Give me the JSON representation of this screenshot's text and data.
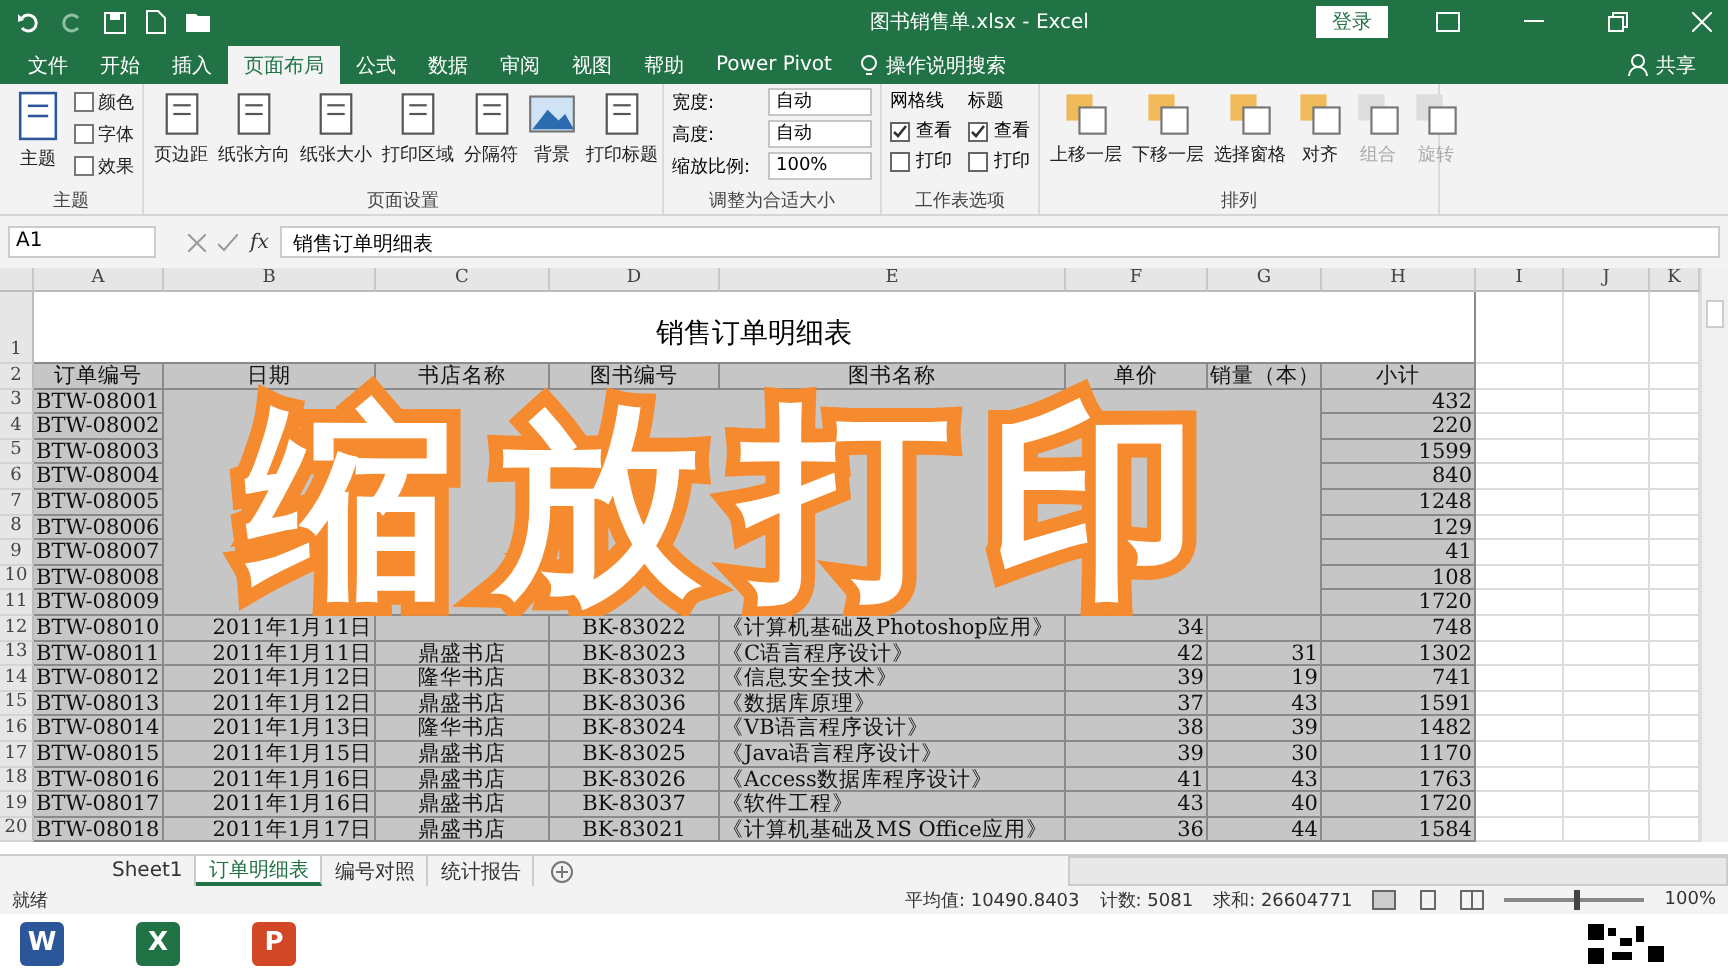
{
  "title_bar": {
    "title": "图书销售单.xlsx  -  Excel",
    "sign_in": "登录"
  },
  "ribbon_tabs": [
    {
      "label": "文件",
      "selected": false
    },
    {
      "label": "开始",
      "selected": false
    },
    {
      "label": "插入",
      "selected": false
    },
    {
      "label": "页面布局",
      "selected": true
    },
    {
      "label": "公式",
      "selected": false
    },
    {
      "label": "数据",
      "selected": false
    },
    {
      "label": "审阅",
      "selected": false
    },
    {
      "label": "视图",
      "selected": false
    },
    {
      "label": "帮助",
      "selected": false
    },
    {
      "label": "Power Pivot",
      "selected": false
    }
  ],
  "tell_me": "操作说明搜索",
  "share": "共享",
  "theme_group": {
    "label": "主题",
    "big": "主题",
    "items": [
      "颜色",
      "字体",
      "效果"
    ]
  },
  "page_setup": {
    "label": "页面设置",
    "buttons": [
      "页边距",
      "纸张方向",
      "纸张大小",
      "打印区域",
      "分隔符",
      "背景",
      "打印标题"
    ]
  },
  "scale_to_fit": {
    "label": "调整为合适大小",
    "fields": [
      {
        "label": "宽度:",
        "value": "自动"
      },
      {
        "label": "高度:",
        "value": "自动"
      },
      {
        "label": "缩放比例:",
        "value": "100%"
      }
    ]
  },
  "sheet_options": {
    "label": "工作表选项",
    "columns": [
      {
        "heading": "网格线",
        "options": [
          {
            "label": "查看",
            "checked": true
          },
          {
            "label": "打印",
            "checked": false
          }
        ]
      },
      {
        "heading": "标题",
        "options": [
          {
            "label": "查看",
            "checked": true
          },
          {
            "label": "打印",
            "checked": false
          }
        ]
      }
    ]
  },
  "arrange": {
    "label": "排列",
    "buttons": [
      {
        "label": "上移一层",
        "disabled": false
      },
      {
        "label": "下移一层",
        "disabled": false
      },
      {
        "label": "选择窗格",
        "disabled": false
      },
      {
        "label": "对齐",
        "disabled": false
      },
      {
        "label": "组合",
        "disabled": true
      },
      {
        "label": "旋转",
        "disabled": true
      }
    ]
  },
  "formula_bar": {
    "name_box": "A1",
    "function_symbol": "fx",
    "value": "销售订单明细表"
  },
  "sheet": {
    "columns": [
      "A",
      "B",
      "C",
      "D",
      "E",
      "F",
      "G",
      "H",
      "I",
      "J",
      "K"
    ],
    "title_row": "1",
    "title": "销售订单明细表",
    "header_row": "2",
    "headers": [
      "订单编号",
      "日期",
      "书店名称",
      "图书编号",
      "图书名称",
      "单价",
      "销量（本）",
      "小计"
    ],
    "rows": [
      {
        "number": "3",
        "cells": [
          "BTW-08001",
          null,
          null,
          null,
          null,
          null,
          null,
          "432"
        ]
      },
      {
        "number": "4",
        "cells": [
          "BTW-08002",
          null,
          null,
          null,
          null,
          null,
          null,
          "220"
        ]
      },
      {
        "number": "5",
        "cells": [
          "BTW-08003",
          null,
          null,
          null,
          null,
          null,
          null,
          "1599"
        ]
      },
      {
        "number": "6",
        "cells": [
          "BTW-08004",
          null,
          null,
          null,
          null,
          null,
          null,
          "840"
        ]
      },
      {
        "number": "7",
        "cells": [
          "BTW-08005",
          null,
          null,
          null,
          null,
          null,
          null,
          "1248"
        ]
      },
      {
        "number": "8",
        "cells": [
          "BTW-08006",
          null,
          null,
          null,
          null,
          null,
          null,
          "129"
        ]
      },
      {
        "number": "9",
        "cells": [
          "BTW-08007",
          null,
          null,
          null,
          null,
          null,
          null,
          "41"
        ]
      },
      {
        "number": "10",
        "cells": [
          "BTW-08008",
          null,
          null,
          null,
          null,
          null,
          null,
          "108"
        ]
      },
      {
        "number": "11",
        "cells": [
          "BTW-08009",
          null,
          null,
          null,
          null,
          null,
          null,
          "1720"
        ]
      },
      {
        "number": "12",
        "cells": [
          "BTW-08010",
          "2011年1月11日",
          null,
          "BK-83022",
          "《计算机基础及Photoshop应用》",
          "34",
          null,
          "748"
        ]
      },
      {
        "number": "13",
        "cells": [
          "BTW-08011",
          "2011年1月11日",
          "鼎盛书店",
          "BK-83023",
          "《C语言程序设计》",
          "42",
          "31",
          "1302"
        ]
      },
      {
        "number": "14",
        "cells": [
          "BTW-08012",
          "2011年1月12日",
          "隆华书店",
          "BK-83032",
          "《信息安全技术》",
          "39",
          "19",
          "741"
        ]
      },
      {
        "number": "15",
        "cells": [
          "BTW-08013",
          "2011年1月12日",
          "鼎盛书店",
          "BK-83036",
          "《数据库原理》",
          "37",
          "43",
          "1591"
        ]
      },
      {
        "number": "16",
        "cells": [
          "BTW-08014",
          "2011年1月13日",
          "隆华书店",
          "BK-83024",
          "《VB语言程序设计》",
          "38",
          "39",
          "1482"
        ]
      },
      {
        "number": "17",
        "cells": [
          "BTW-08015",
          "2011年1月15日",
          "鼎盛书店",
          "BK-83025",
          "《Java语言程序设计》",
          "39",
          "30",
          "1170"
        ]
      },
      {
        "number": "18",
        "cells": [
          "BTW-08016",
          "2011年1月16日",
          "鼎盛书店",
          "BK-83026",
          "《Access数据库程序设计》",
          "41",
          "43",
          "1763"
        ]
      },
      {
        "number": "19",
        "cells": [
          "BTW-08017",
          "2011年1月16日",
          "鼎盛书店",
          "BK-83037",
          "《软件工程》",
          "43",
          "40",
          "1720"
        ]
      },
      {
        "number": "20",
        "cells": [
          "BTW-08018",
          "2011年1月17日",
          "鼎盛书店",
          "BK-83021",
          "《计算机基础及MS Office应用》",
          "36",
          "44",
          "1584"
        ]
      }
    ]
  },
  "caption": "缩放打印",
  "sheet_tabs": [
    {
      "label": "Sheet1",
      "selected": false
    },
    {
      "label": "订单明细表",
      "selected": true
    },
    {
      "label": "编号对照",
      "selected": false
    },
    {
      "label": "统计报告",
      "selected": false
    }
  ],
  "status_bar": {
    "ready": "就绪",
    "average": "平均值: 10490.8403",
    "count": "计数: 5081",
    "sum": "求和: 26604771",
    "zoom": "100%",
    "zoom_slider": {
      "level": 0.5
    }
  },
  "dock": [
    {
      "letter": "W",
      "color": "#2b579a"
    },
    {
      "letter": "X",
      "color": "#217346"
    },
    {
      "letter": "P",
      "color": "#d24726"
    }
  ]
}
